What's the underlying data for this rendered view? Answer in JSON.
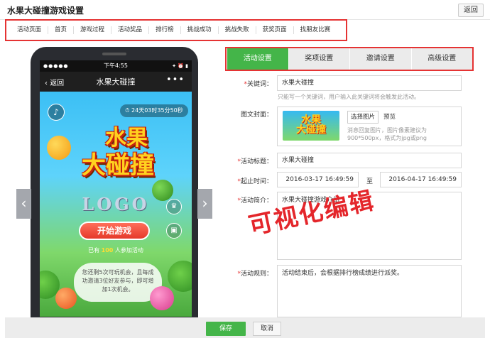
{
  "page": {
    "title": "水果大碰撞游戏设置",
    "back_label": "返回"
  },
  "nav": {
    "items": [
      "活动页面",
      "首页",
      "游戏过程",
      "活动奖品",
      "排行榜",
      "挑战成功",
      "挑战失败",
      "获奖页面",
      "找朋友比赛"
    ]
  },
  "phone": {
    "status_time": "下午4:55",
    "status_dots": "●●●●●",
    "status_right": "✦ ⏰ ▮",
    "back_label": "返回",
    "app_title": "水果大碰撞",
    "more": "•••",
    "countdown": "24天03时35分50秒",
    "logo_line1": "水果",
    "logo_line2": "大碰撞",
    "logo_text": "LOGO",
    "start_label": "开始游戏",
    "join_prefix": "已有",
    "join_count": "100",
    "join_suffix": "人参加活动",
    "tip": "您还剩5次可玩机会，且每成功邀请3位好友参与，即可增加1次机会。"
  },
  "tabs": [
    {
      "label": "活动设置",
      "active": true
    },
    {
      "label": "奖项设置",
      "active": false
    },
    {
      "label": "邀请设置",
      "active": false
    },
    {
      "label": "高级设置",
      "active": false
    }
  ],
  "form": {
    "keyword_label": "关键词：",
    "keyword_value": "水果大碰撞",
    "keyword_hint": "只能写一个关键词，用户输入此关键词将会触发此活动。",
    "cover_label": "图文封面：",
    "cover_thumb_text": "水果\n大碰撞",
    "choose_image": "选择图片",
    "preview": "预览",
    "cover_hint": "消息回复图片，图片像素建议为900*500px，格式为jpg或png",
    "title_label": "活动标题：",
    "title_value": "水果大碰撞",
    "time_label": "起止时间：",
    "start_time": "2016-03-17 16:49:59",
    "to": "至",
    "end_time": "2016-04-17 16:49:59",
    "intro_label": "活动简介：",
    "intro_value": "水果大碰撞游戏介绍",
    "rules_label": "活动规则：",
    "rules_value": "活动结束后，会根据排行榜成绩进行派奖。"
  },
  "overlay": "可视化编辑",
  "footer": {
    "save_label": "保存",
    "cancel_label": "取消"
  },
  "colors": {
    "accent": "#44b549",
    "highlight": "#e53333"
  }
}
